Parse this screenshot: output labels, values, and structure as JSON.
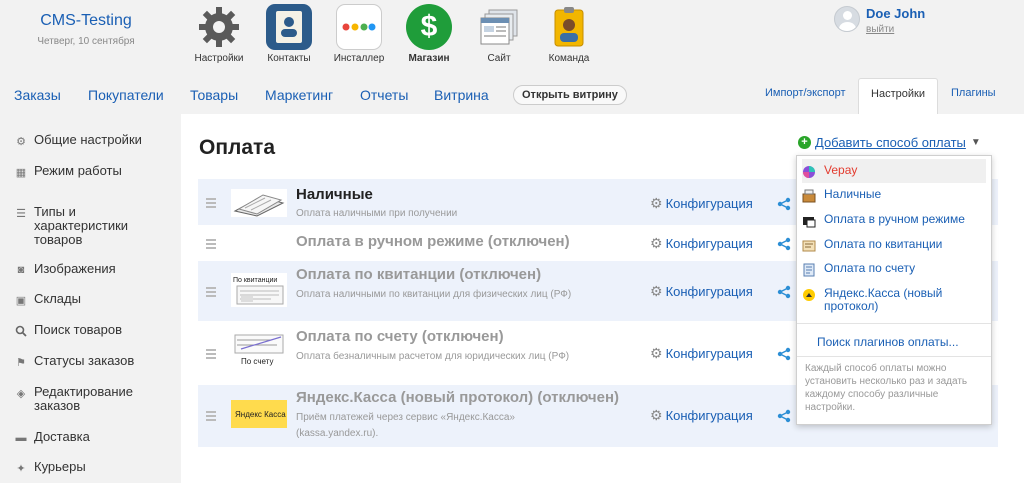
{
  "brand": {
    "name": "CMS-Testing",
    "date": "Четверг, 10 сентября"
  },
  "apps": [
    {
      "label": "Настройки",
      "icon": "gear-icon"
    },
    {
      "label": "Контакты",
      "icon": "contacts-book-icon"
    },
    {
      "label": "Инсталлер",
      "icon": "installer-dots-icon"
    },
    {
      "label": "Магазин",
      "icon": "dollar-icon",
      "active": true
    },
    {
      "label": "Сайт",
      "icon": "site-pages-icon"
    },
    {
      "label": "Команда",
      "icon": "team-badge-icon"
    }
  ],
  "user": {
    "name": "Doe John",
    "logout": "выйти"
  },
  "nav": {
    "items": [
      "Заказы",
      "Покупатели",
      "Товары",
      "Маркетинг",
      "Отчеты",
      "Витрина"
    ],
    "open_storefront": "Открыть витрину",
    "right_tabs": [
      "Импорт/экспорт",
      "Настройки",
      "Плагины"
    ],
    "active_right_tab": "Настройки"
  },
  "sidebar": {
    "items": [
      {
        "label": "Общие настройки",
        "icon": "settings-pair-icon"
      },
      {
        "label": "Режим работы",
        "icon": "calendar-icon"
      },
      {
        "label": "Типы и характеристики товаров",
        "icon": "list-icon"
      },
      {
        "label": "Изображения",
        "icon": "camera-icon"
      },
      {
        "label": "Склады",
        "icon": "box-icon"
      },
      {
        "label": "Поиск товаров",
        "icon": "search-icon"
      },
      {
        "label": "Статусы заказов",
        "icon": "flag-icon"
      },
      {
        "label": "Редактирование заказов",
        "icon": "layers-icon"
      },
      {
        "label": "Доставка",
        "icon": "truck-icon"
      },
      {
        "label": "Курьеры",
        "icon": "runner-icon"
      }
    ]
  },
  "page": {
    "title": "Оплата",
    "add_method_label": "Добавить способ оплаты",
    "config_label": "Конфигурация"
  },
  "payments": [
    {
      "name": "Наличные",
      "desc": "Оплата наличными при получении",
      "enabled": true,
      "logo": "cash-logo"
    },
    {
      "name": "Оплата в ручном режиме (отключен)",
      "desc": "",
      "enabled": false,
      "logo": ""
    },
    {
      "name": "Оплата по квитанции (отключен)",
      "desc": "Оплата наличными по квитанции для физических лиц (РФ)",
      "enabled": false,
      "logo": "receipt-logo",
      "logo_text": "По квитанции"
    },
    {
      "name": "Оплата по счету (отключен)",
      "desc": "Оплата безналичным расчетом для юридических лиц (РФ)",
      "enabled": false,
      "logo": "invoice-logo",
      "logo_text": "По счету"
    },
    {
      "name": "Яндекс.Касса (новый протокол) (отключен)",
      "desc": "Приём платежей через сервис «Яндекс.Касса» (kassa.yandex.ru).",
      "enabled": false,
      "logo": "yandex-kassa-logo",
      "logo_text": "Яндекс Касса"
    }
  ],
  "dropdown": {
    "items": [
      {
        "label": "Vepay",
        "icon": "vepay-icon"
      },
      {
        "label": "Наличные",
        "icon": "cash-register-icon"
      },
      {
        "label": "Оплата в ручном режиме",
        "icon": "manual-payment-icon"
      },
      {
        "label": "Оплата по квитанции",
        "icon": "receipt-icon"
      },
      {
        "label": "Оплата по счету",
        "icon": "invoice-icon"
      },
      {
        "label": "Яндекс.Касса (новый протокол)",
        "icon": "yandex-kassa-icon"
      }
    ],
    "search_link": "Поиск плагинов оплаты...",
    "hint": "Каждый способ оплаты можно установить несколько раз и задать каждому способу различные настройки."
  },
  "colors": {
    "link": "#1a5fb4",
    "highlight": "#e33b2e",
    "row_alt": "#edf2fb",
    "green": "#1f9d3a"
  }
}
